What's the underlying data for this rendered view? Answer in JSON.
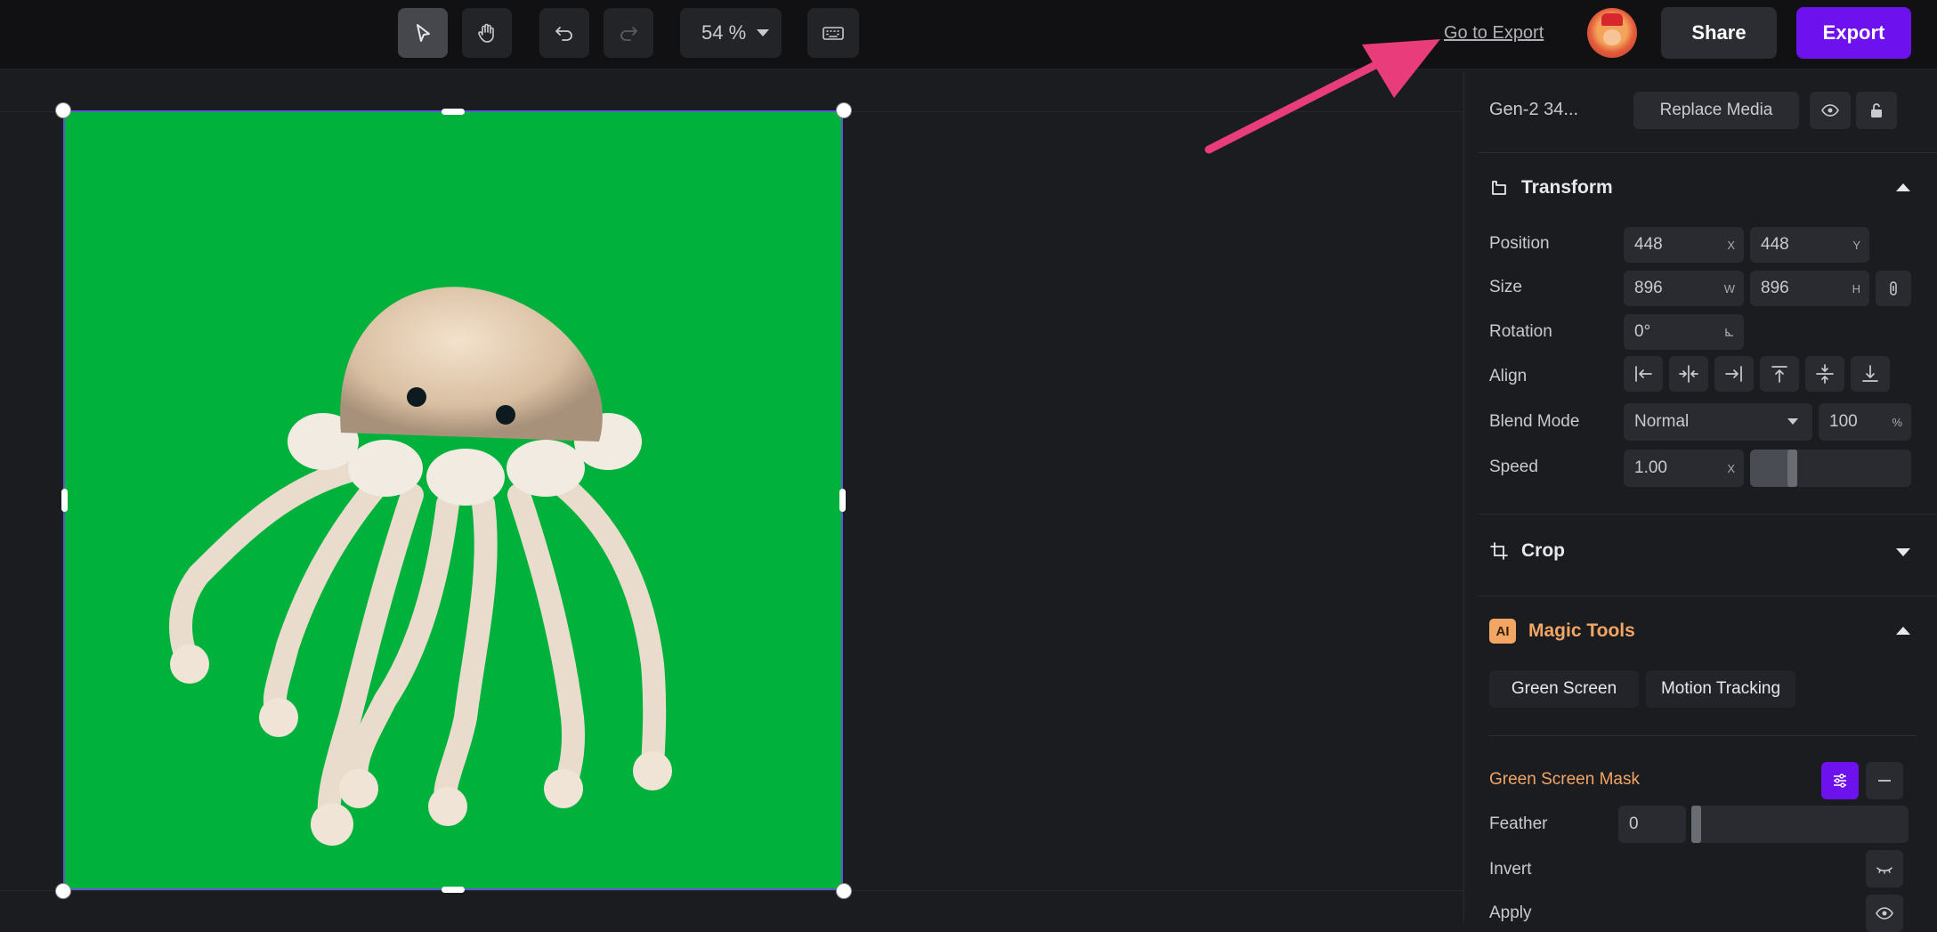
{
  "toolbar": {
    "zoom_value": "54 %",
    "go_to_export": "Go to Export",
    "share_label": "Share",
    "export_label": "Export"
  },
  "colors": {
    "accent": "#6d12ef",
    "green_screen": "#00b13c",
    "arrow": "#e83d7a",
    "magic_orange": "#f3a564"
  },
  "panel": {
    "media_title": "Gen-2 34...",
    "replace_media": "Replace Media",
    "transform": {
      "title": "Transform",
      "position_label": "Position",
      "position_x": "448",
      "position_x_suffix": "X",
      "position_y": "448",
      "position_y_suffix": "Y",
      "size_label": "Size",
      "size_w": "896",
      "size_w_suffix": "W",
      "size_h": "896",
      "size_h_suffix": "H",
      "rotation_label": "Rotation",
      "rotation_value": "0°",
      "align_label": "Align",
      "blend_label": "Blend Mode",
      "blend_value": "Normal",
      "opacity_value": "100",
      "opacity_suffix": "%",
      "speed_label": "Speed",
      "speed_value": "1.00",
      "speed_suffix": "X",
      "speed_slider_fraction": 0.23
    },
    "crop": {
      "title": "Crop"
    },
    "magic": {
      "badge": "AI",
      "title": "Magic Tools",
      "green_screen": "Green Screen",
      "motion_tracking": "Motion Tracking",
      "mask_title": "Green Screen Mask",
      "feather_label": "Feather",
      "feather_value": "0",
      "feather_slider_fraction": 0.0,
      "invert_label": "Invert",
      "apply_label": "Apply"
    }
  }
}
